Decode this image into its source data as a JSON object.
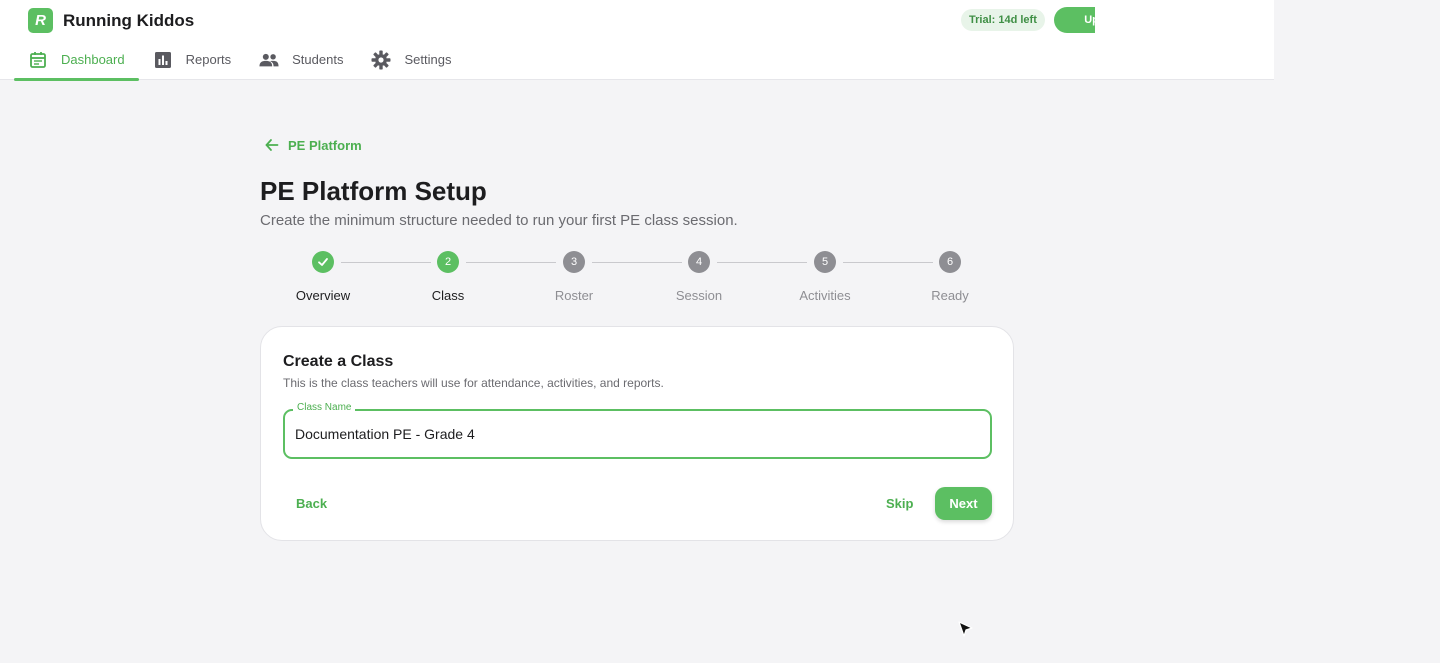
{
  "app": {
    "name": "Running Kiddos",
    "logo_letter": "R",
    "trial_badge": "Trial: 14d left",
    "upgrade_label": "Upgrade"
  },
  "nav": {
    "items": [
      {
        "label": "Dashboard",
        "icon": "calendar-icon",
        "active": true
      },
      {
        "label": "Reports",
        "icon": "bar-chart-icon",
        "active": false
      },
      {
        "label": "Students",
        "icon": "people-icon",
        "active": false
      },
      {
        "label": "Settings",
        "icon": "gear-icon",
        "active": false
      }
    ]
  },
  "breadcrumb": {
    "back_label": "PE Platform"
  },
  "page": {
    "title": "PE Platform Setup",
    "subtitle": "Create the minimum structure needed to run your first PE class session."
  },
  "stepper": {
    "steps": [
      {
        "number": "1",
        "label": "Overview",
        "state": "done"
      },
      {
        "number": "2",
        "label": "Class",
        "state": "current"
      },
      {
        "number": "3",
        "label": "Roster",
        "state": "todo"
      },
      {
        "number": "4",
        "label": "Session",
        "state": "todo"
      },
      {
        "number": "5",
        "label": "Activities",
        "state": "todo"
      },
      {
        "number": "6",
        "label": "Ready",
        "state": "todo"
      }
    ]
  },
  "card": {
    "title": "Create a Class",
    "description": "This is the class teachers will use for attendance, activities, and reports.",
    "field_label": "Class Name",
    "field_value": "Documentation PE - Grade 4",
    "back_label": "Back",
    "skip_label": "Skip",
    "next_label": "Next"
  },
  "colors": {
    "accent": "#5cbf62",
    "accent_text": "#4caf50",
    "muted": "#8e8e93",
    "background": "#f4f4f6"
  }
}
